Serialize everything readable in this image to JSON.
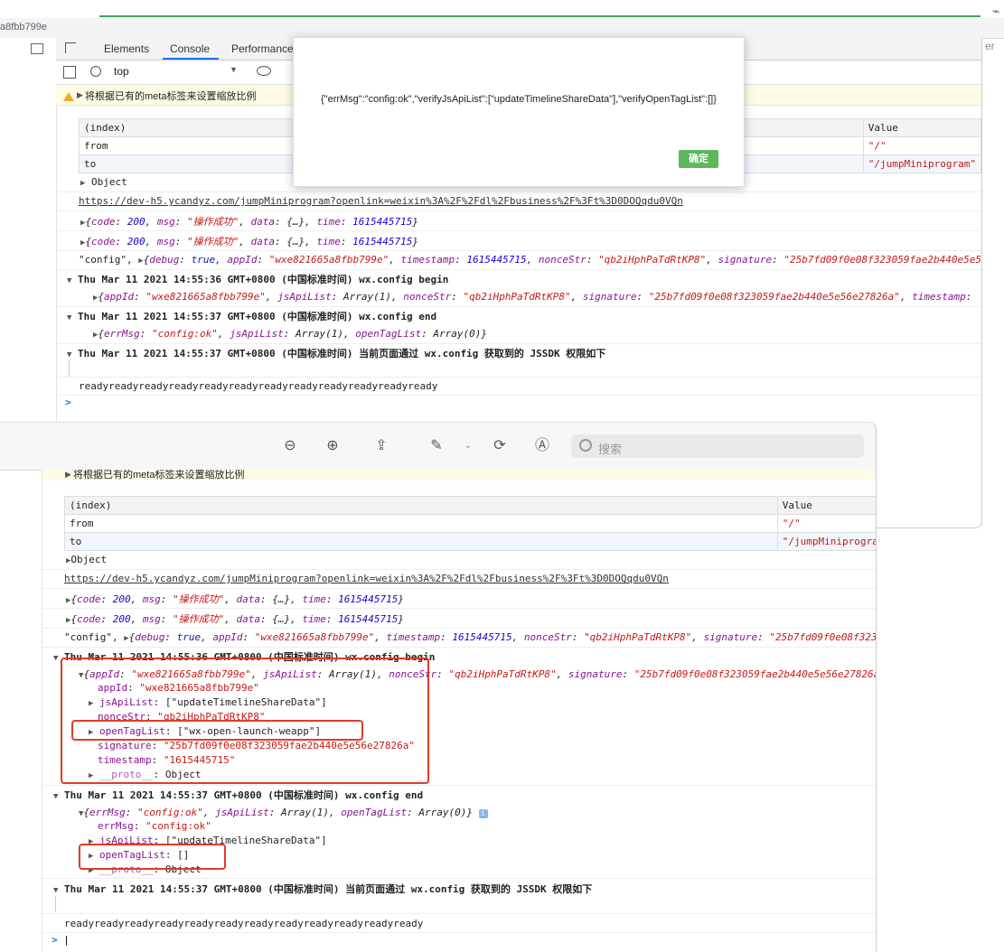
{
  "browser": {
    "url_fragment": "a8fbb799e",
    "right_edge_text": "er"
  },
  "devtools": {
    "tabs": [
      "Elements",
      "Console",
      "Performance"
    ],
    "context": "top",
    "warning": "将根据已有的meta标签来设置缩放比例",
    "table": {
      "headers": [
        "(index)",
        "Value"
      ],
      "rows": [
        {
          "index": "from",
          "value": "\"/\""
        },
        {
          "index": "to",
          "value": "\"/jumpMiniprogram\""
        }
      ]
    },
    "object_label": "Object",
    "link": "https://dev-h5.ycandyz.com/jumpMiniprogram?openlink=weixin%3A%2F%2Fdl%2Fbusiness%2F%3Ft%3D0DOQqdu0VQn",
    "code_lines": [
      {
        "code": "200",
        "msg": "\"操作成功\"",
        "time": "1615445715"
      },
      {
        "code": "200",
        "msg": "\"操作成功\"",
        "time": "1615445715"
      }
    ],
    "config_line": {
      "prefix": "\"config\",",
      "appId": "\"wxe821665a8fbb799e\"",
      "timestamp": "1615445715",
      "nonceStr": "\"qb2iHphPaTdRtKP8\"",
      "signature": "\"25b7fd09f0e08f323059fae2b440e5e56e27826a\""
    },
    "group1": "Thu Mar 11 2021 14:55:36 GMT+0800 (中国标准时间) wx.config begin",
    "group1_item": {
      "appId": "\"wxe821665a8fbb799e\"",
      "jsApiList": "Array(1)",
      "nonceStr": "\"qb2iHphPaTdRtKP8\"",
      "signature": "\"25b7fd09f0e08f323059fae2b440e5e56e27826a\""
    },
    "group2": "Thu Mar 11 2021 14:55:37 GMT+0800 (中国标准时间) wx.config end",
    "group2_item": {
      "errMsg": "\"config:ok\"",
      "jsApiList": "Array(1)",
      "openTagList": "Array(0)"
    },
    "group3": "Thu Mar 11 2021 14:55:37 GMT+0800 (中国标准时间) 当前页面通过 wx.config 获取到的 JSSDK 权限如下",
    "ready_text": "readyreadyreadyreadyreadyreadyreadyreadyreadyreadyreadyready",
    "prompt": ">"
  },
  "dialog": {
    "message": "{\"errMsg\":\"config:ok\",\"verifyJsApiList\":[\"updateTimelineShareData\"],\"verifyOpenTagList\":[]}",
    "confirm_label": "确定"
  },
  "preview": {
    "search_placeholder": "搜索",
    "warning": "将根据已有的meta标签来设置缩放比例",
    "expanded1": {
      "appId": "\"wxe821665a8fbb799e\"",
      "jsApiList": "[\"updateTimelineShareData\"]",
      "nonceStr": "\"qb2iHphPaTdRtKP8\"",
      "openTagList": "[\"wx-open-launch-weapp\"]",
      "signature": "\"25b7fd09f0e08f323059fae2b440e5e56e27826a\"",
      "timestamp": "\"1615445715\"",
      "proto": "Object"
    },
    "expanded2": {
      "errMsg": "\"config:ok\"",
      "jsApiList": "[\"updateTimelineShareData\"]",
      "openTagList": "[]",
      "proto": "Object"
    }
  },
  "colors": {
    "highlight_box": "#e23b27",
    "confirm_button": "#5cb85c",
    "string": "#c41a16",
    "property": "#881391",
    "number": "#1c00cf"
  }
}
